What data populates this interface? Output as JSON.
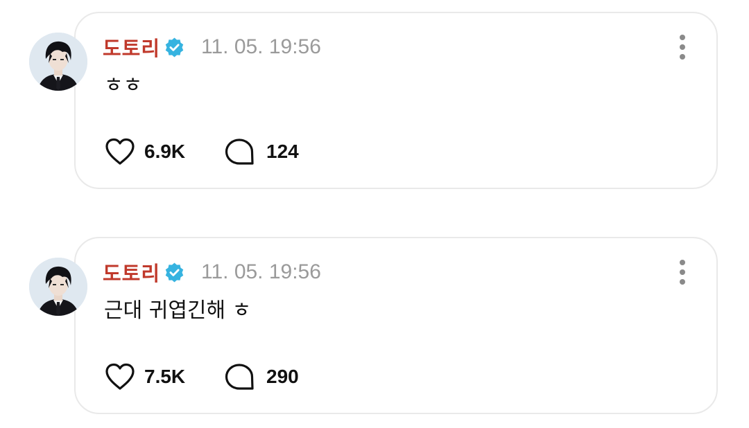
{
  "posts": [
    {
      "author": "도토리",
      "verified_icon": "verified-badge-icon",
      "timestamp": "11. 05. 19:56",
      "text": "ㅎㅎ",
      "likes": "6.9K",
      "replies": "124",
      "more_icon": "kebab-menu-icon"
    },
    {
      "author": "도토리",
      "verified_icon": "verified-badge-icon",
      "timestamp": "11. 05. 19:56",
      "text": "근대 귀엽긴해 ㅎ",
      "likes": "7.5K",
      "replies": "290",
      "more_icon": "kebab-menu-icon"
    }
  ],
  "colors": {
    "author_name": "#c0392b",
    "verified_badge": "#36b3e0",
    "timestamp": "#9a9a9a",
    "card_border": "#e9e9e9",
    "text": "#111111"
  }
}
